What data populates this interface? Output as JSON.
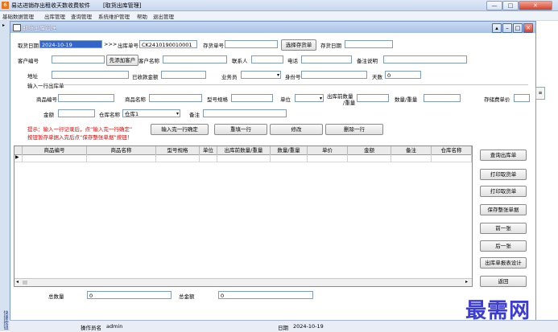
{
  "app": {
    "title": "易达进销存出租收天数收费软件",
    "subtitle": "[取货出库管理]",
    "icon_glyph": "6"
  },
  "window_controls": {
    "minimize": "—",
    "maximize": "□",
    "close": "✕"
  },
  "menu": [
    "基础数据管理",
    "出库管理",
    "查询管理",
    "系统维护管理",
    "帮助",
    "退出管理"
  ],
  "inner_window": {
    "caption": "取货出库管理",
    "buttons": {
      "a": "▴",
      "min": "–",
      "max": "□",
      "close": "✕"
    }
  },
  "form": {
    "take_date_label": "取货日期",
    "take_date_value": "2024-10-19",
    "arrows": ">>>",
    "out_no_label": "出库单号",
    "out_no_value": "CK2410190010001",
    "deposit_no_label": "存货单号",
    "deposit_no_value": "",
    "select_deposit_button": "选择存货单",
    "deposit_date_label": "存货日期",
    "deposit_date_value": "",
    "customer_no_label": "客户编号",
    "customer_no_value": "",
    "add_customer_button": "先添加客户",
    "customer_name_label": "客户名称",
    "customer_name_value": "",
    "contact_label": "联系人",
    "contact_value": "",
    "phone_label": "电话",
    "phone_value": "",
    "remark_label": "备注说明",
    "remark_value": "",
    "address_label": "地址",
    "address_value": "",
    "received_label": "已收款金额",
    "received_value": "",
    "salesman_label": "业务员",
    "salesman_value": "",
    "idcard_label": "身份号",
    "idcard_value": "",
    "days_label": "天数",
    "days_value": "0",
    "section_label": "输入一行出库单",
    "product_no_label": "商品编号",
    "product_no_value": "",
    "product_name_label": "商品名称",
    "product_name_value": "",
    "spec_label": "型号规格",
    "spec_value": "",
    "unit_label": "单位",
    "unit_value": "",
    "pre_qty_label_1": "出库前数量",
    "pre_qty_label_2": "/重量",
    "pre_qty_value": "",
    "qty_label": "数量/重量",
    "qty_value": "",
    "price_label": "存储费单价",
    "price_value": "",
    "amount_label": "金额",
    "amount_value": "",
    "warehouse_label": "仓库名称",
    "warehouse_value": "仓库1",
    "note_label": "备注",
    "note_value": "",
    "hint_line1": "提示：输入一行记录后，点“输入完一行确定”",
    "hint_line2": "按钮暂存单据入完后点“保存整张单据”按钮！",
    "confirm_row_button": "输入完一行确定",
    "clear_row_button": "重填一行",
    "edit_button": "修改",
    "delete_row_button": "删除一行"
  },
  "grid": {
    "columns": [
      "商品编号",
      "商品名称",
      "型号规格",
      "单位",
      "出库前数量/重量",
      "数量/重量",
      "单价",
      "金额",
      "备注",
      "仓库名称"
    ],
    "row_marker": "▶"
  },
  "right_buttons": [
    "查询出库单",
    "打印取货单",
    "打印取货单",
    "保存整张单据",
    "前一张",
    "后一张",
    "出库单报表设计",
    "返回"
  ],
  "totals": {
    "total_qty_label": "总数量",
    "total_qty_value": "0",
    "total_amount_label": "总金额",
    "total_amount_value": "0"
  },
  "side_strip": {
    "arrow": "▸",
    "label": "快捷按钮"
  },
  "status": {
    "operator_label": "操作员名",
    "operator_value": "admin",
    "date_label": "日期",
    "date_value": "2024-10-19"
  },
  "watermark": "最需网",
  "colors": {
    "hint_red": "#e00000",
    "titlebar": "#c7d8ee",
    "watermark": "#3b3bd6"
  }
}
